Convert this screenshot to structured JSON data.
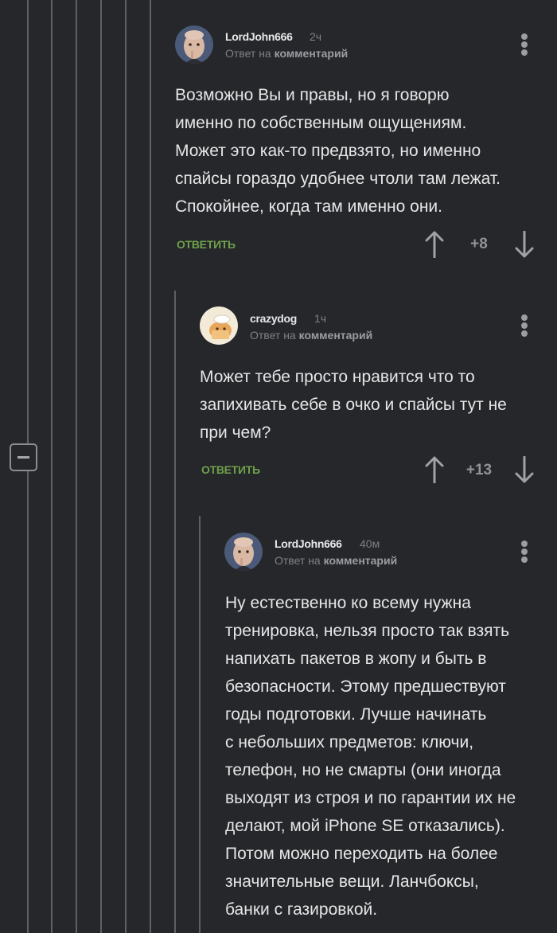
{
  "comments": [
    {
      "username": "LordJohn666",
      "time": "2ч",
      "reply_prefix": "Ответ на",
      "reply_target": "комментарий",
      "text": "Возможно Вы и правы, но я говорю\nименно по собственным ощущениям.\nМожет это как-то предвзято, но именно\nспайсы гораздо удобнее чтоли там лежат.\nСпокойнее, когда там именно они.",
      "reply_label": "ОТВЕТИТЬ",
      "rating": "+8"
    },
    {
      "username": "crazydog",
      "time": "1ч",
      "reply_prefix": "Ответ на",
      "reply_target": "комментарий",
      "text": "Может тебе просто нравится что то\nзапихивать себе в очко и спайсы тут не\nпри чем?",
      "reply_label": "ОТВЕТИТЬ",
      "rating": "+13"
    },
    {
      "username": "LordJohn666",
      "time": "40м",
      "reply_prefix": "Ответ на",
      "reply_target": "комментарий",
      "text": "Ну естественно ко всему нужна\nтренировка, нельзя просто так взять\nнапихать пакетов в жопу и быть в\nбезопасности. Этому предшествуют\nгоды подготовки. Лучше начинать\nс небольших предметов: ключи,\nтелефон, но не смарты (они иногда\nвыходят из строя и по гарантии их не\nделают, мой iPhone SE отказались).\nПотом можно переходить на более\nзначительные вещи. Ланчбоксы,\nбанки с газировкой."
    }
  ],
  "colors": {
    "background": "#25272b",
    "reply_green": "#6fa04a",
    "thread_line": "#5d6066"
  }
}
